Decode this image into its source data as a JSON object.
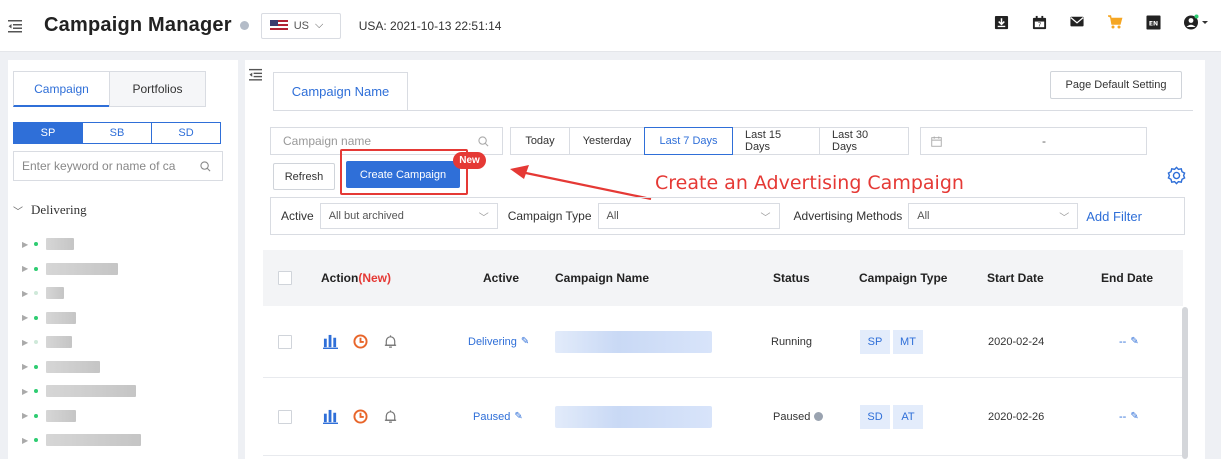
{
  "header": {
    "title": "Campaign Manager",
    "market": "US",
    "clock": "USA: 2021-10-13 22:51:14"
  },
  "left_panel": {
    "tabs": [
      {
        "label": "Campaign"
      },
      {
        "label": "Portfolios"
      }
    ],
    "segments": [
      {
        "label": "SP"
      },
      {
        "label": "SB"
      },
      {
        "label": "SD"
      }
    ],
    "search_placeholder": "Enter keyword or name of ca",
    "tree_group": "Delivering"
  },
  "main": {
    "tab_label": "Campaign Name",
    "page_default_setting": "Page Default Setting",
    "campaign_name_placeholder": "Campaign name",
    "date_buttons": [
      {
        "label": "Today"
      },
      {
        "label": "Yesterday"
      },
      {
        "label": "Last 7 Days"
      },
      {
        "label": "Last 15 Days"
      },
      {
        "label": "Last 30 Days"
      }
    ],
    "date_range_sep": "-",
    "refresh_label": "Refresh",
    "create_label": "Create Campaign",
    "new_badge": "New",
    "annotation": "Create an Advertising Campaign",
    "filters": {
      "active_label": "Active",
      "active_value": "All but archived",
      "type_label": "Campaign Type",
      "type_value": "All",
      "method_label": "Advertising Methods",
      "method_value": "All",
      "add_filter": "Add Filter"
    }
  },
  "table": {
    "headers": {
      "action": "Action",
      "action_new": "(New)",
      "active": "Active",
      "campaign_name": "Campaign Name",
      "status": "Status",
      "campaign_type": "Campaign Type",
      "start_date": "Start Date",
      "end_date": "End Date"
    },
    "rows": [
      {
        "active": "Delivering",
        "status": "Running",
        "type1": "SP",
        "type2": "MT",
        "start": "2020-02-24",
        "end": "--"
      },
      {
        "active": "Paused",
        "status": "Paused",
        "type1": "SD",
        "type2": "AT",
        "start": "2020-02-26",
        "end": "--"
      }
    ]
  },
  "colors": {
    "accent": "#2f6fd8",
    "highlight": "#e53935",
    "status_dot": "#2ecc71"
  }
}
